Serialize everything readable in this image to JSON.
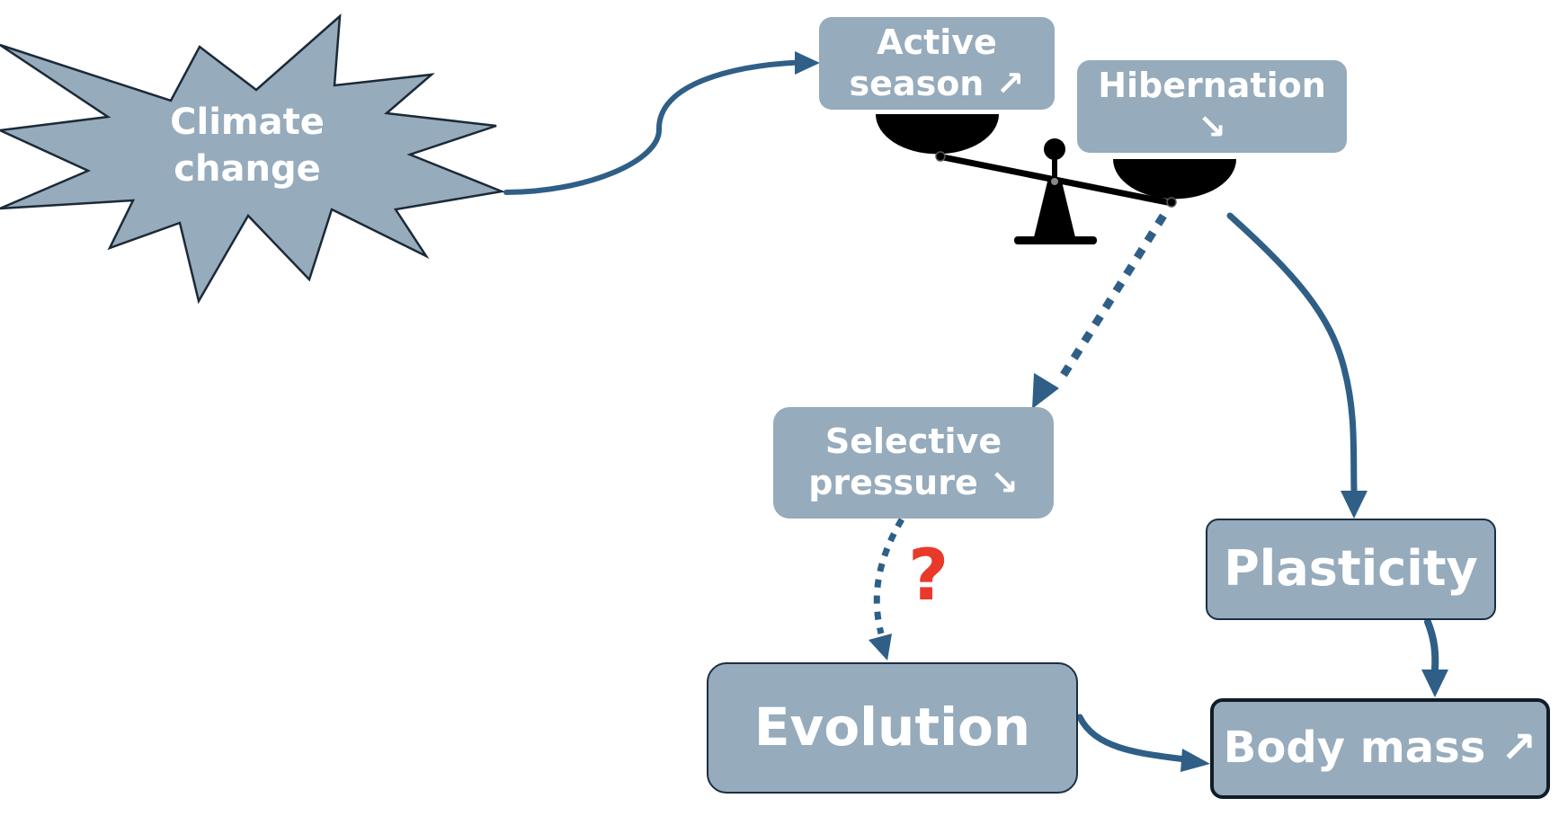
{
  "climate": {
    "line1": "Climate",
    "line2": "change"
  },
  "active_season": {
    "line1": "Active",
    "line2": "season ↗"
  },
  "hibernation": {
    "line1": "Hibernation",
    "line2": "↘"
  },
  "selective_pressure": {
    "line1": "Selective",
    "line2": "pressure ↘"
  },
  "plasticity": {
    "label": "Plasticity"
  },
  "evolution": {
    "label": "Evolution"
  },
  "body_mass": {
    "label": "Body mass ↗"
  },
  "question_mark": "?",
  "colors": {
    "box_fill": "#96abbc",
    "arrow": "#2f5f86",
    "box_border_dark": "#1b2f44",
    "question": "#e8392b",
    "scale": "#000000"
  }
}
